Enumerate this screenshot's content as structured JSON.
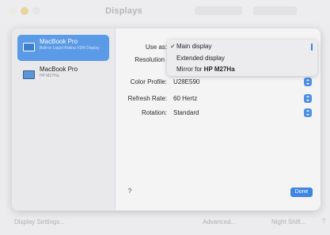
{
  "window": {
    "title": "Displays"
  },
  "displays": [
    {
      "name": "MacBook Pro",
      "subtitle": "Built-in Liquid Retina XDR Display",
      "selected": true
    },
    {
      "name": "MacBook Pro",
      "subtitle": "HP M27Ha",
      "selected": false
    }
  ],
  "settings": {
    "use_as_label": "Use as:",
    "resolution_label": "Resolution",
    "color_profile_label": "Color Profile:",
    "color_profile_value": "U28E590",
    "refresh_rate_label": "Refresh Rate:",
    "refresh_rate_value": "60 Hertz",
    "rotation_label": "Rotation:",
    "rotation_value": "Standard"
  },
  "use_as_menu": {
    "items": [
      {
        "check": "✓",
        "label": "Main display",
        "bold_suffix": ""
      },
      {
        "check": "",
        "label": "Extended display",
        "bold_suffix": ""
      },
      {
        "check": "",
        "label": "Mirror for ",
        "bold_suffix": "HP M27Ha"
      }
    ]
  },
  "buttons": {
    "help": "?",
    "done": "Done"
  },
  "bottom": {
    "display_settings": "Display Settings...",
    "advanced": "Advanced...",
    "night_shift": "Night Shift...",
    "help": "?"
  },
  "colors": {
    "accent": "#3f85e8",
    "selection": "#5a9ae6"
  }
}
